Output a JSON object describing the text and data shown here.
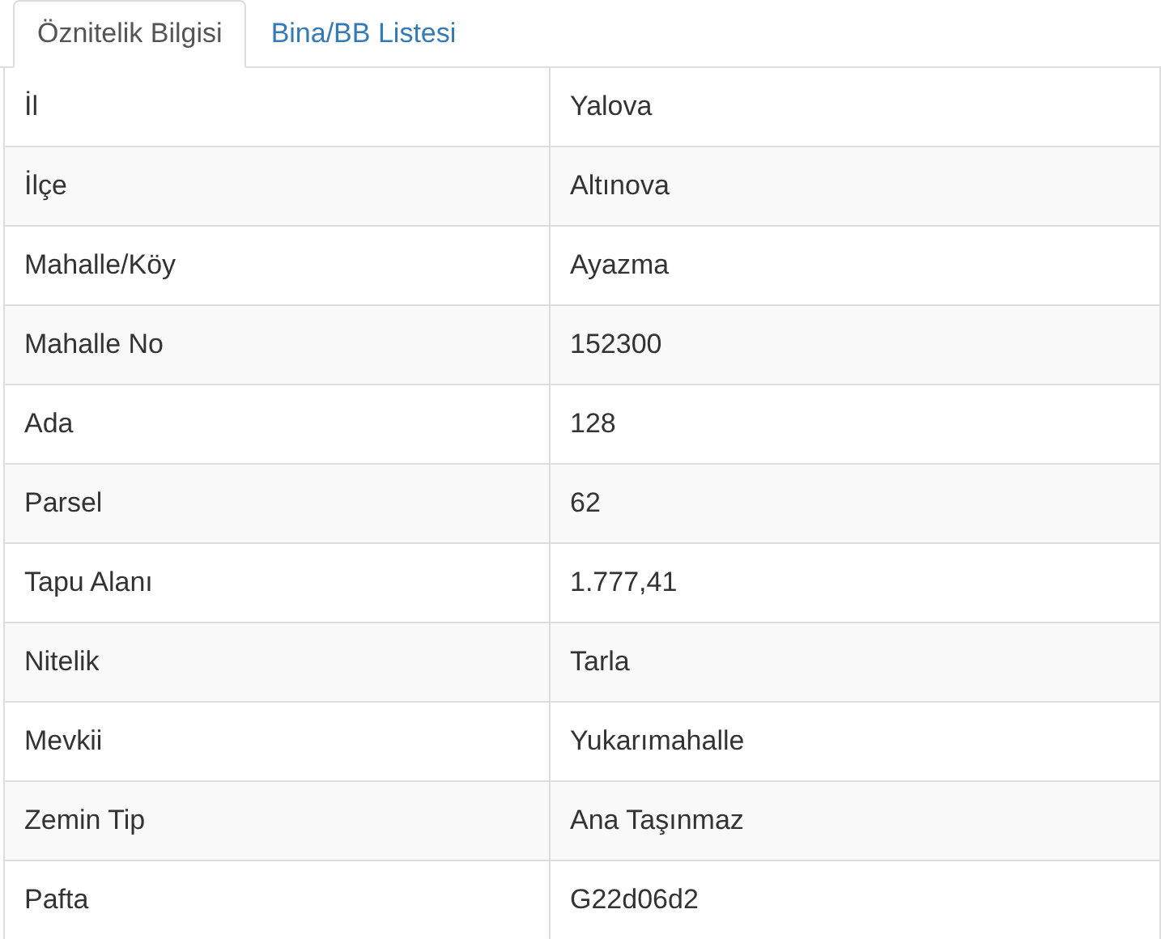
{
  "tabs": [
    {
      "label": "Öznitelik Bilgisi",
      "selected": true
    },
    {
      "label": "Bina/BB Listesi",
      "selected": false
    }
  ],
  "table": {
    "rows": [
      {
        "label": "İl",
        "value": "Yalova"
      },
      {
        "label": "İlçe",
        "value": "Altınova"
      },
      {
        "label": "Mahalle/Köy",
        "value": "Ayazma"
      },
      {
        "label": "Mahalle No",
        "value": "152300"
      },
      {
        "label": "Ada",
        "value": "128"
      },
      {
        "label": "Parsel",
        "value": "62"
      },
      {
        "label": "Tapu Alanı",
        "value": "1.777,41"
      },
      {
        "label": "Nitelik",
        "value": "Tarla"
      },
      {
        "label": "Mevkii",
        "value": "Yukarımahalle"
      },
      {
        "label": "Zemin Tip",
        "value": "Ana Taşınmaz"
      },
      {
        "label": "Pafta",
        "value": "G22d06d2"
      }
    ]
  }
}
